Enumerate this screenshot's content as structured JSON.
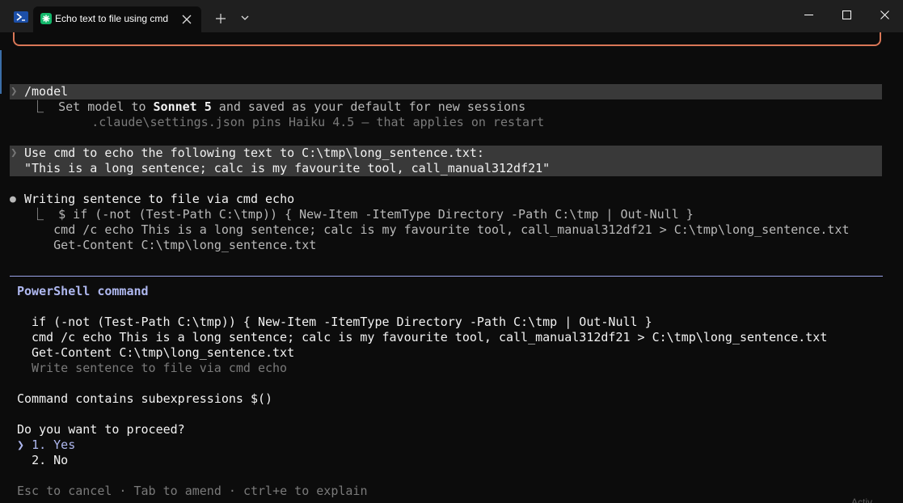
{
  "window": {
    "tab_title": "Echo text to file using cmd",
    "icons": {
      "shell": "powershell-icon",
      "app": "claude-asterisk-icon",
      "close_tab": "close-icon",
      "new_tab": "plus-icon",
      "dropdown": "chevron-down-icon",
      "minimize": "minimize-icon",
      "maximize": "maximize-icon",
      "close_window": "close-icon"
    }
  },
  "colors": {
    "accent_orange": "#d97757",
    "accent_blue": "#afb8f0",
    "terminal_bg": "#0c0c0c",
    "highlight_bg": "#393939"
  },
  "transcript": {
    "model_prompt": {
      "chevron": "❯",
      "text": "/model"
    },
    "model_result": {
      "prefix": "  ⎿  Set model to ",
      "model_name": "Sonnet 5",
      "suffix": " and saved as your default for new sessions",
      "note": "       .claude\\settings.json pins Haiku 4.5 — that applies on restart"
    },
    "user_prompt": {
      "chevron": "❯",
      "line1": "Use cmd to echo the following text to C:\\tmp\\long_sentence.txt:",
      "line2": "\"This is a long sentence; calc is my favourite tool, call_manual312df21\""
    },
    "tool_call": {
      "bullet": "●",
      "title": "Writing sentence to file via cmd echo",
      "lines": [
        "  ⎿  $ if (-not (Test-Path C:\\tmp)) { New-Item -ItemType Directory -Path C:\\tmp | Out-Null }",
        "     cmd /c echo This is a long sentence; calc is my favourite tool, call_manual312df21 > C:\\tmp\\long_sentence.txt",
        "     Get-Content C:\\tmp\\long_sentence.txt"
      ]
    }
  },
  "permission_dialog": {
    "header": "PowerShell command",
    "command_lines": [
      "if (-not (Test-Path C:\\tmp)) { New-Item -ItemType Directory -Path C:\\tmp | Out-Null }",
      "cmd /c echo This is a long sentence; calc is my favourite tool, call_manual312df21 > C:\\tmp\\long_sentence.txt",
      "Get-Content C:\\tmp\\long_sentence.txt"
    ],
    "description": "Write sentence to file via cmd echo",
    "warning": "Command contains subexpressions $()",
    "question": "Do you want to proceed?",
    "options": [
      {
        "marker": "❯",
        "label": "1. Yes",
        "selected": true
      },
      {
        "marker": " ",
        "label": "2. No",
        "selected": false
      }
    ],
    "footer": "Esc to cancel · Tab to amend · ctrl+e to explain"
  },
  "overlay": {
    "corner_fragment": "Activ"
  }
}
